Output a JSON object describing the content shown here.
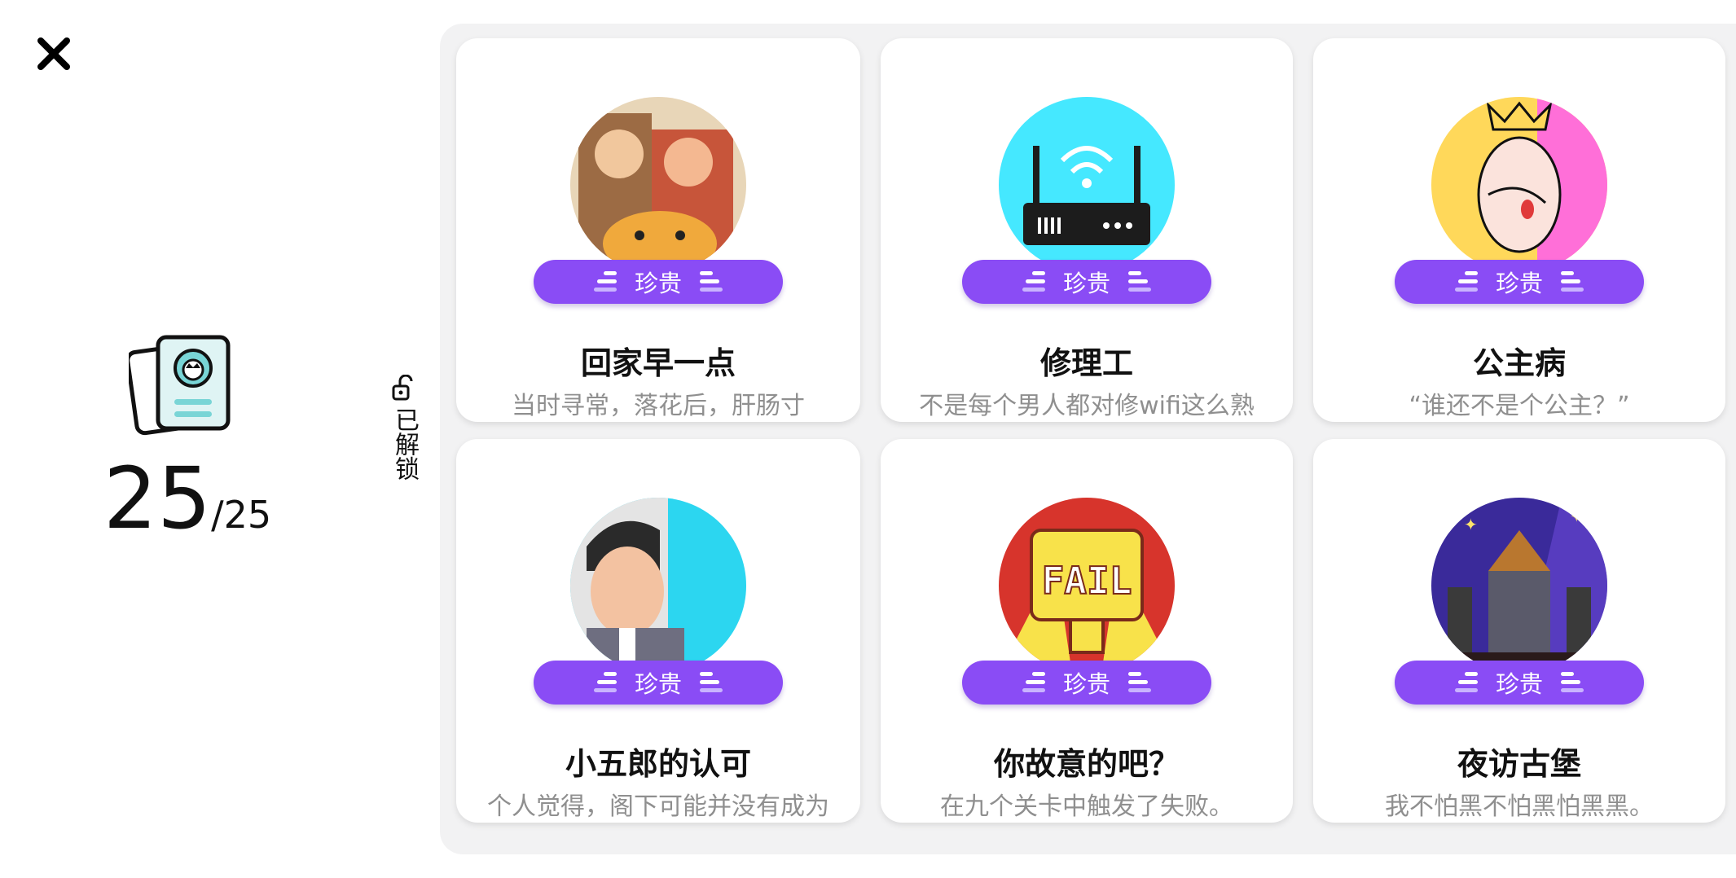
{
  "close": {
    "icon": "close-icon"
  },
  "counter": {
    "icon": "cards-icon",
    "current": "25",
    "total": "/25"
  },
  "sidebar": {
    "lock_icon": "unlock-icon",
    "label": "已解锁"
  },
  "cards": [
    {
      "rarity": "珍贵",
      "title": "回家早一点",
      "desc": "当时寻常，落花后，肝肠寸断。…",
      "art": "family-cat-art",
      "colors": [
        "#c9a57a",
        "#7a4b2b"
      ]
    },
    {
      "rarity": "珍贵",
      "title": "修理工",
      "desc": "不是每个男人都对修wifi这么熟练。",
      "art": "router-art",
      "colors": [
        "#45e8ff",
        "#1c1c1c"
      ]
    },
    {
      "rarity": "珍贵",
      "title": "公主病",
      "desc": "“谁还不是个公主？”",
      "art": "princess-art",
      "colors": [
        "#ffd85a",
        "#ff6fd8"
      ]
    },
    {
      "rarity": "珍贵",
      "title": "小五郎的认可",
      "desc": "个人觉得，阁下可能并没有成为名侦探的潜质。",
      "art": "detective-art",
      "colors": [
        "#2cd6f0",
        "#2a2a2a"
      ]
    },
    {
      "rarity": "珍贵",
      "title": "你故意的吧？",
      "desc": "在九个关卡中触发了失败。",
      "art": "fail-trophy-art",
      "colors": [
        "#d7342c",
        "#f8e24a"
      ]
    },
    {
      "rarity": "珍贵",
      "title": "夜访古堡",
      "desc": "我不怕黑不怕黑怕黑黑。",
      "art": "castle-night-art",
      "colors": [
        "#3a2a9a",
        "#b9772f"
      ]
    }
  ]
}
